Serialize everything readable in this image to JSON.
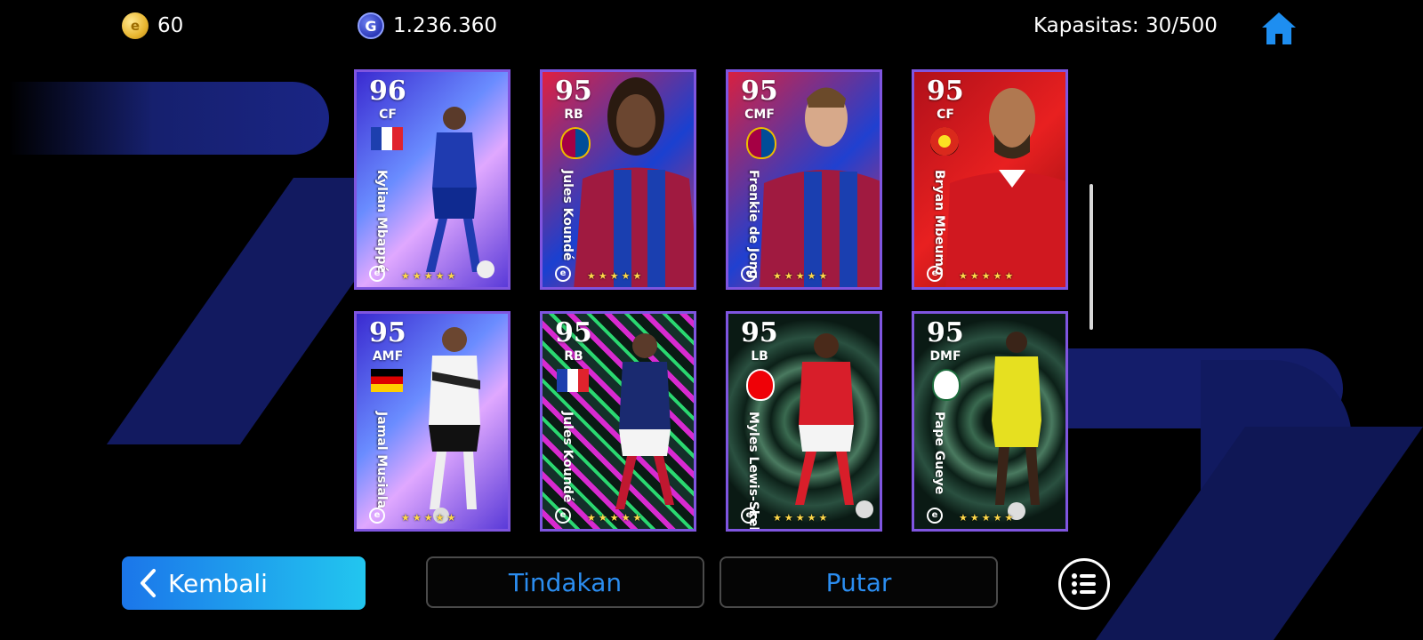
{
  "topbar": {
    "coins_value": "60",
    "coins_icon": "efootball-coin-icon",
    "gp_value": "1.236.360",
    "gp_icon": "gp-icon",
    "gp_letter": "G",
    "capacity_text": "Kapasitas: 30/500",
    "home_icon": "home-icon"
  },
  "cards": [
    {
      "rating": "96",
      "position": "CF",
      "name": "Kylian Mbappé",
      "badge": "france-flag-icon",
      "stars": "★★★★★"
    },
    {
      "rating": "95",
      "position": "RB",
      "name": "Jules Koundé",
      "badge": "fc-barcelona-crest-icon",
      "stars": "★★★★★"
    },
    {
      "rating": "95",
      "position": "CMF",
      "name": "Frenkie de Jong",
      "badge": "fc-barcelona-crest-icon",
      "stars": "★★★★★"
    },
    {
      "rating": "95",
      "position": "CF",
      "name": "Bryan Mbeumo",
      "badge": "manchester-united-crest-icon",
      "stars": "★★★★★"
    },
    {
      "rating": "95",
      "position": "AMF",
      "name": "Jamal Musiala",
      "badge": "germany-flag-icon",
      "stars": "★★★★★"
    },
    {
      "rating": "95",
      "position": "RB",
      "name": "Jules Koundé",
      "badge": "france-flag-icon",
      "stars": "★★★★★"
    },
    {
      "rating": "95",
      "position": "LB",
      "name": "Myles Lewis-Skelly",
      "badge": "arsenal-crest-icon",
      "stars": "★★★★★"
    },
    {
      "rating": "95",
      "position": "DMF",
      "name": "Pape Gueye",
      "badge": "club-crest-icon",
      "stars": "★★★★★"
    }
  ],
  "buttons": {
    "back_label": "Kembali",
    "actions_label": "Tindakan",
    "rotate_label": "Putar",
    "menu_icon": "list-menu-icon"
  },
  "colors": {
    "accent_blue": "#2b8df0",
    "card_border": "#7f55e0",
    "star_yellow": "#ffd94a"
  }
}
